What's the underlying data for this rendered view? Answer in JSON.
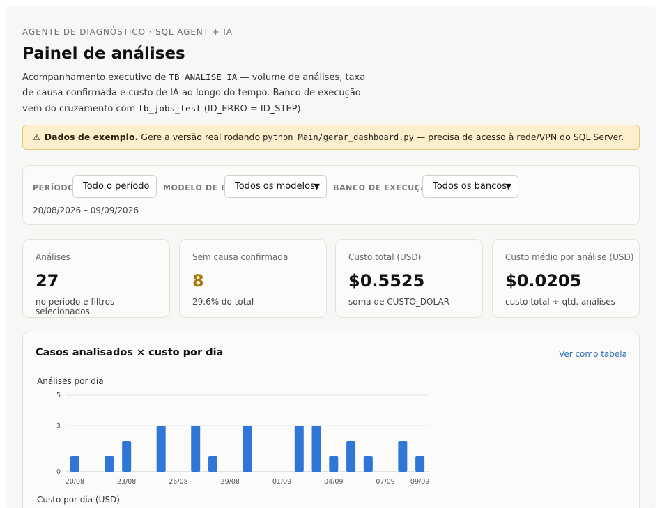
{
  "header": {
    "eyebrow": "AGENTE DE DIAGNÓSTICO · SQL AGENT + IA",
    "title": "Painel de análises",
    "desc_part1": "Acompanhamento executivo de ",
    "desc_code1": "TB_ANALISE_IA",
    "desc_part2": " — volume de análises, taxa de causa confirmada e custo de IA ao longo do tempo. Banco de execução vem do cruzamento com ",
    "desc_code2": "tb_jobs_test",
    "desc_part3": " (ID_ERRO = ID_STEP)."
  },
  "notice": {
    "icon": "warning-icon",
    "strong": "Dados de exemplo.",
    "text1": " Gere a versão real rodando ",
    "code": "python Main/gerar_dashboard.py",
    "text2": " — precisa de acesso à rede/VPN do SQL Server."
  },
  "filters": {
    "periodo_label": "PERÍODO",
    "periodo_value": "Todo o período",
    "modelo_label": "MODELO DE IA",
    "modelo_value": "Todos os modelos",
    "banco_label": "BANCO DE EXECUÇÃO",
    "banco_value": "Todos os bancos",
    "range": "20/08/2026 – 09/09/2026"
  },
  "kpis": [
    {
      "label": "Análises",
      "value": "27",
      "sub": "no período e filtros selecionados"
    },
    {
      "label": "Sem causa confirmada",
      "value": "8",
      "sub": "29.6% do total"
    },
    {
      "label": "Custo total (USD)",
      "value": "$0.5525",
      "sub": "soma de CUSTO_DOLAR"
    },
    {
      "label": "Custo médio por análise (USD)",
      "value": "$0.0205",
      "sub": "custo total ÷ qtd. análises"
    }
  ],
  "colors": {
    "bar": "#2f76d6",
    "warn_value": "#a8770e",
    "link": "#2f6db2"
  },
  "chart_section": {
    "title": "Casos analisados × custo por dia",
    "link": "Ver como tabela",
    "sub1": "Análises por dia",
    "sub2": "Custo por dia (USD)"
  },
  "chart_data": {
    "type": "bar",
    "title": "Análises por dia",
    "x": [
      "20/08",
      "21/08",
      "22/08",
      "23/08",
      "24/08",
      "25/08",
      "26/08",
      "27/08",
      "28/08",
      "29/08",
      "30/08",
      "31/08",
      "01/09",
      "02/09",
      "03/09",
      "04/09",
      "05/09",
      "06/09",
      "07/09",
      "08/09",
      "09/09"
    ],
    "values": [
      1,
      0,
      1,
      2,
      0,
      3,
      0,
      3,
      1,
      0,
      3,
      0,
      0,
      3,
      3,
      1,
      2,
      1,
      0,
      2,
      1
    ],
    "tick_labels_x": [
      "20/08",
      "23/08",
      "26/08",
      "29/08",
      "01/09",
      "04/09",
      "07/09",
      "09/09"
    ],
    "yticks": [
      0,
      3,
      5
    ],
    "ylim": [
      0,
      5
    ]
  }
}
